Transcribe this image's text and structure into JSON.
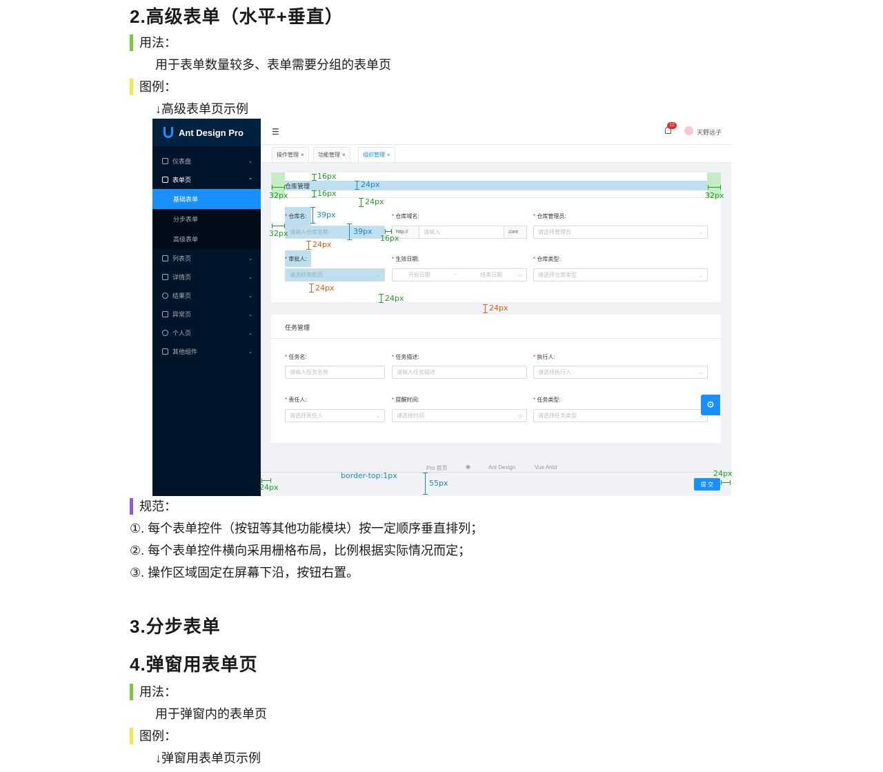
{
  "section2": {
    "title": "2.高级表单（水平+垂直）",
    "usage_label": "用法：",
    "usage_text": "用于表单数量较多、表单需要分组的表单页",
    "example_label": "图例：",
    "example_text": "↓高级表单页示例"
  },
  "app": {
    "logo": "Ant Design Pro",
    "menu": [
      {
        "label": "仪表盘"
      },
      {
        "label": "表单页"
      },
      {
        "label": "列表页"
      },
      {
        "label": "详情页"
      },
      {
        "label": "结果页"
      },
      {
        "label": "异常页"
      },
      {
        "label": "个人页"
      },
      {
        "label": "其他组件"
      }
    ],
    "submenu": [
      "基础表单",
      "分步表单",
      "高级表单"
    ],
    "badge": "12",
    "user": "天野远子",
    "tabs": [
      "操作管理",
      "功能管理",
      "组织管理"
    ],
    "card1": {
      "title": "仓库管理",
      "labels": [
        "仓库名:",
        "仓库域名:",
        "仓库管理员:",
        "审批人:",
        "生效日期:",
        "仓库类型:"
      ],
      "placeholders": [
        "请输入仓库名称",
        "请输入",
        "请选择管理员",
        "请选择审批员",
        "开始日期",
        "结束日期",
        "请选择仓库类型"
      ],
      "addon_before": "http://",
      "addon_after": ".com",
      "tilde": "~"
    },
    "card2": {
      "title": "任务管理",
      "labels": [
        "任务名:",
        "任务描述:",
        "执行人:",
        "责任人:",
        "提醒时间:",
        "任务类型:"
      ],
      "placeholders": [
        "请输入任务名称",
        "请输入任务描述",
        "请选择执行人",
        "请选择责任人",
        "请选择时间",
        "请选择任务类型"
      ]
    },
    "footer": {
      "links": [
        "Pro 首页",
        "Ant Design",
        "Vue Antd"
      ]
    },
    "submit": "提 交"
  },
  "measures": {
    "m16": "16px",
    "m24": "24px",
    "m32": "32px",
    "m39": "39px",
    "m55": "55px",
    "border": "border-top:1px"
  },
  "rules": {
    "label": "规范：",
    "items": [
      "①. 每个表单控件（按钮等其他功能模块）按一定顺序垂直排列；",
      "②. 每个表单控件横向采用栅格布局，比例根据实际情况而定；",
      "③. 操作区域固定在屏幕下沿，按钮右置。"
    ]
  },
  "section3": {
    "title": "3.分步表单"
  },
  "section4": {
    "title": "4.弹窗用表单页",
    "usage_label": "用法：",
    "usage_text": "用于弹窗内的表单页",
    "example_label": "图例：",
    "example_text": "↓弹窗用表单页示例"
  },
  "colors": {
    "green": "#7ac943",
    "yellow": "#f5e642",
    "purple": "#9b59d0",
    "primary": "#1890ff",
    "sider": "#001529"
  }
}
